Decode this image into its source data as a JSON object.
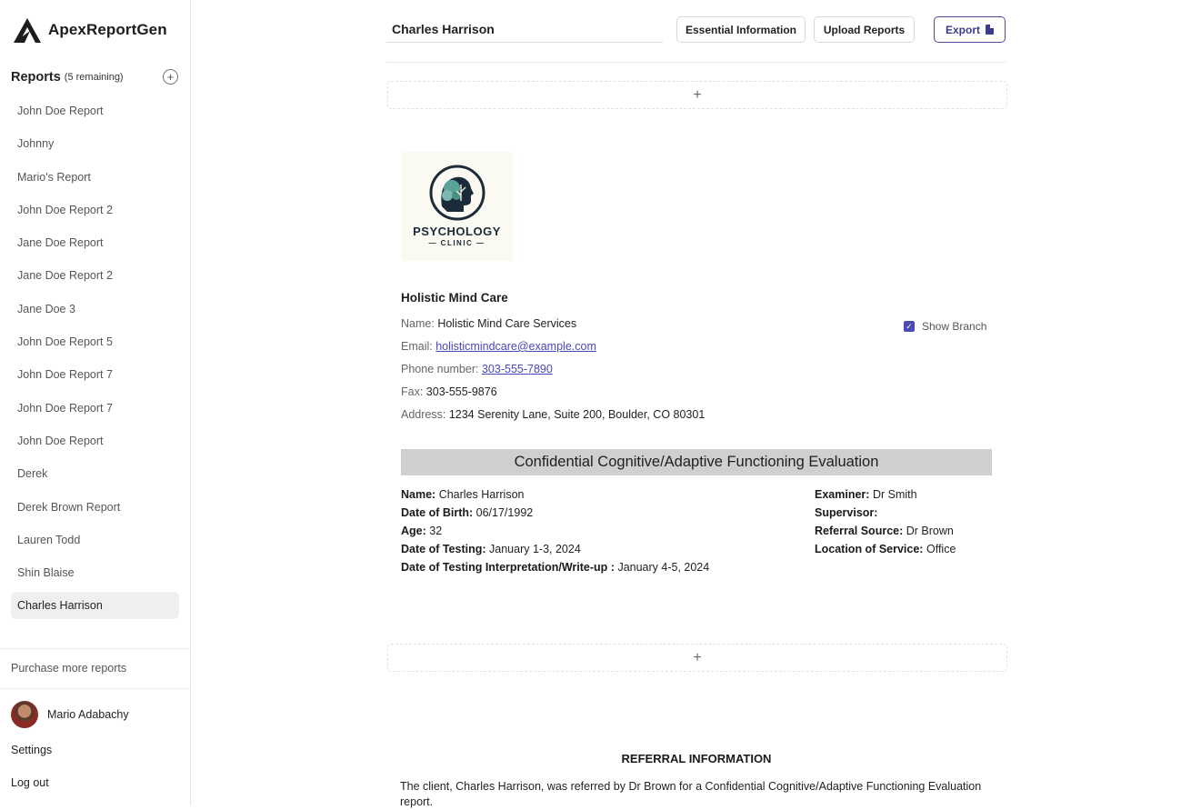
{
  "app": {
    "name": "ApexReportGen"
  },
  "sidebar": {
    "reports_title": "Reports",
    "reports_remaining": "(5 remaining)",
    "items": [
      {
        "label": "John Doe Report"
      },
      {
        "label": "Johnny"
      },
      {
        "label": "Mario's Report"
      },
      {
        "label": "John Doe Report 2"
      },
      {
        "label": "Jane Doe Report"
      },
      {
        "label": "Jane Doe Report 2"
      },
      {
        "label": "Jane Doe 3"
      },
      {
        "label": "John Doe Report 5"
      },
      {
        "label": "John Doe Report 7"
      },
      {
        "label": "John Doe Report 7"
      },
      {
        "label": "John Doe Report"
      },
      {
        "label": "Derek"
      },
      {
        "label": "Derek Brown Report"
      },
      {
        "label": "Lauren Todd"
      },
      {
        "label": "Shin Blaise"
      },
      {
        "label": "Charles Harrison",
        "active": true
      }
    ],
    "purchase": "Purchase more reports",
    "user_name": "Mario Adabachy",
    "settings": "Settings",
    "logout": "Log out"
  },
  "toolbar": {
    "report_name": "Charles Harrison",
    "essential_info": "Essential Information",
    "upload_reports": "Upload Reports",
    "export": "Export"
  },
  "add_block_symbol": "+",
  "clinic": {
    "logo_title": "PSYCHOLOGY",
    "logo_sub": "— CLINIC —",
    "title": "Holistic Mind Care",
    "name_label": "Name:",
    "name": "Holistic Mind Care Services",
    "email_label": "Email:",
    "email": "holisticmindcare@example.com",
    "phone_label": "Phone number:",
    "phone": "303-555-7890",
    "fax_label": "Fax:",
    "fax": "303-555-9876",
    "address_label": "Address:",
    "address": "1234 Serenity Lane, Suite 200, Boulder, CO 80301",
    "show_branch": "Show Branch"
  },
  "evaluation": {
    "title": "Confidential Cognitive/Adaptive Functioning Evaluation",
    "left": [
      {
        "label": "Name:",
        "value": "Charles Harrison"
      },
      {
        "label": "Date of Birth:",
        "value": "06/17/1992"
      },
      {
        "label": "Age:",
        "value": "32"
      },
      {
        "label": "Date of Testing:",
        "value": "January 1-3, 2024"
      },
      {
        "label": "Date of Testing Interpretation/Write-up :",
        "value": "January 4-5, 2024"
      }
    ],
    "right": [
      {
        "label": "Examiner:",
        "value": "Dr Smith"
      },
      {
        "label": "Supervisor:",
        "value": ""
      },
      {
        "label": "Referral Source:",
        "value": "Dr Brown"
      },
      {
        "label": "Location of Service:",
        "value": "Office"
      }
    ]
  },
  "referral": {
    "title": "REFERRAL INFORMATION",
    "text": "The client, Charles Harrison, was referred by Dr Brown for a Confidential Cognitive/Adaptive Functioning Evaluation report."
  }
}
